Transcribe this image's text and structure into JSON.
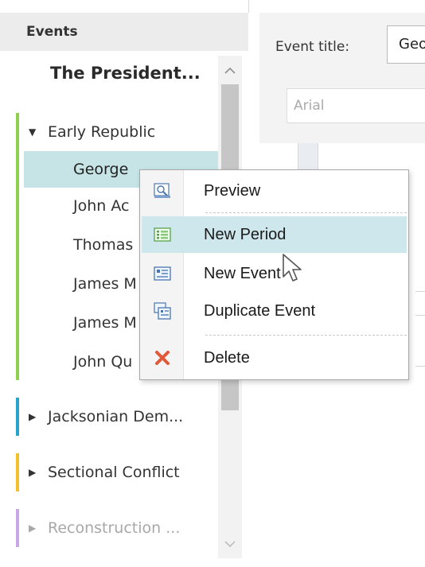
{
  "sidebar": {
    "header": "Events",
    "root_title": "The President...",
    "groups": [
      {
        "label": "Early Republic",
        "expanded": true,
        "color": "#8fd14f"
      },
      {
        "label": "Jacksonian Dem...",
        "expanded": false,
        "color": "#29a3c9"
      },
      {
        "label": "Sectional Conflict",
        "expanded": false,
        "color": "#f2c12e"
      },
      {
        "label": "Reconstruction ...",
        "expanded": false,
        "color": "#c9a8e6"
      }
    ],
    "events": [
      "George",
      "John Ac",
      "Thomas",
      "James M",
      "James M",
      "John Qu"
    ]
  },
  "editor": {
    "title_label": "Event title:",
    "title_value": "Geor",
    "font_value": "Arial"
  },
  "context_menu": {
    "items": [
      {
        "label": "Preview",
        "icon": "preview-icon"
      },
      {
        "label": "New Period",
        "icon": "new-period-icon"
      },
      {
        "label": "New Event",
        "icon": "new-event-icon"
      },
      {
        "label": "Duplicate Event",
        "icon": "duplicate-event-icon"
      },
      {
        "label": "Delete",
        "icon": "delete-icon"
      }
    ],
    "highlight_color": "#cde7ec",
    "delete_color": "#e05a3a"
  }
}
